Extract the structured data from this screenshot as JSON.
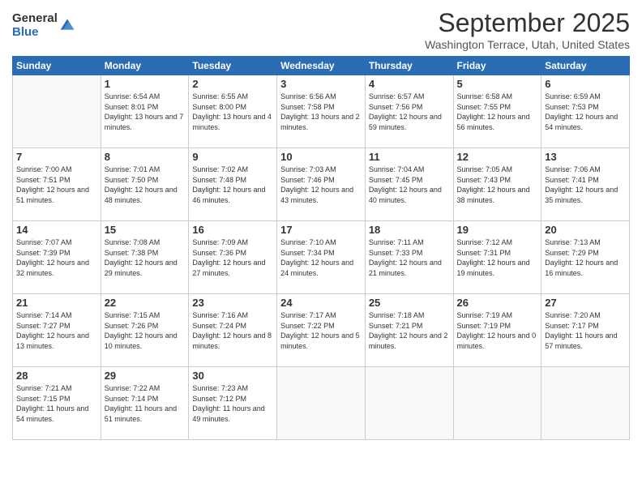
{
  "logo": {
    "general": "General",
    "blue": "Blue"
  },
  "header": {
    "month": "September 2025",
    "location": "Washington Terrace, Utah, United States"
  },
  "weekdays": [
    "Sunday",
    "Monday",
    "Tuesday",
    "Wednesday",
    "Thursday",
    "Friday",
    "Saturday"
  ],
  "weeks": [
    [
      {
        "day": "",
        "sunrise": "",
        "sunset": "",
        "daylight": ""
      },
      {
        "day": "1",
        "sunrise": "Sunrise: 6:54 AM",
        "sunset": "Sunset: 8:01 PM",
        "daylight": "Daylight: 13 hours and 7 minutes."
      },
      {
        "day": "2",
        "sunrise": "Sunrise: 6:55 AM",
        "sunset": "Sunset: 8:00 PM",
        "daylight": "Daylight: 13 hours and 4 minutes."
      },
      {
        "day": "3",
        "sunrise": "Sunrise: 6:56 AM",
        "sunset": "Sunset: 7:58 PM",
        "daylight": "Daylight: 13 hours and 2 minutes."
      },
      {
        "day": "4",
        "sunrise": "Sunrise: 6:57 AM",
        "sunset": "Sunset: 7:56 PM",
        "daylight": "Daylight: 12 hours and 59 minutes."
      },
      {
        "day": "5",
        "sunrise": "Sunrise: 6:58 AM",
        "sunset": "Sunset: 7:55 PM",
        "daylight": "Daylight: 12 hours and 56 minutes."
      },
      {
        "day": "6",
        "sunrise": "Sunrise: 6:59 AM",
        "sunset": "Sunset: 7:53 PM",
        "daylight": "Daylight: 12 hours and 54 minutes."
      }
    ],
    [
      {
        "day": "7",
        "sunrise": "Sunrise: 7:00 AM",
        "sunset": "Sunset: 7:51 PM",
        "daylight": "Daylight: 12 hours and 51 minutes."
      },
      {
        "day": "8",
        "sunrise": "Sunrise: 7:01 AM",
        "sunset": "Sunset: 7:50 PM",
        "daylight": "Daylight: 12 hours and 48 minutes."
      },
      {
        "day": "9",
        "sunrise": "Sunrise: 7:02 AM",
        "sunset": "Sunset: 7:48 PM",
        "daylight": "Daylight: 12 hours and 46 minutes."
      },
      {
        "day": "10",
        "sunrise": "Sunrise: 7:03 AM",
        "sunset": "Sunset: 7:46 PM",
        "daylight": "Daylight: 12 hours and 43 minutes."
      },
      {
        "day": "11",
        "sunrise": "Sunrise: 7:04 AM",
        "sunset": "Sunset: 7:45 PM",
        "daylight": "Daylight: 12 hours and 40 minutes."
      },
      {
        "day": "12",
        "sunrise": "Sunrise: 7:05 AM",
        "sunset": "Sunset: 7:43 PM",
        "daylight": "Daylight: 12 hours and 38 minutes."
      },
      {
        "day": "13",
        "sunrise": "Sunrise: 7:06 AM",
        "sunset": "Sunset: 7:41 PM",
        "daylight": "Daylight: 12 hours and 35 minutes."
      }
    ],
    [
      {
        "day": "14",
        "sunrise": "Sunrise: 7:07 AM",
        "sunset": "Sunset: 7:39 PM",
        "daylight": "Daylight: 12 hours and 32 minutes."
      },
      {
        "day": "15",
        "sunrise": "Sunrise: 7:08 AM",
        "sunset": "Sunset: 7:38 PM",
        "daylight": "Daylight: 12 hours and 29 minutes."
      },
      {
        "day": "16",
        "sunrise": "Sunrise: 7:09 AM",
        "sunset": "Sunset: 7:36 PM",
        "daylight": "Daylight: 12 hours and 27 minutes."
      },
      {
        "day": "17",
        "sunrise": "Sunrise: 7:10 AM",
        "sunset": "Sunset: 7:34 PM",
        "daylight": "Daylight: 12 hours and 24 minutes."
      },
      {
        "day": "18",
        "sunrise": "Sunrise: 7:11 AM",
        "sunset": "Sunset: 7:33 PM",
        "daylight": "Daylight: 12 hours and 21 minutes."
      },
      {
        "day": "19",
        "sunrise": "Sunrise: 7:12 AM",
        "sunset": "Sunset: 7:31 PM",
        "daylight": "Daylight: 12 hours and 19 minutes."
      },
      {
        "day": "20",
        "sunrise": "Sunrise: 7:13 AM",
        "sunset": "Sunset: 7:29 PM",
        "daylight": "Daylight: 12 hours and 16 minutes."
      }
    ],
    [
      {
        "day": "21",
        "sunrise": "Sunrise: 7:14 AM",
        "sunset": "Sunset: 7:27 PM",
        "daylight": "Daylight: 12 hours and 13 minutes."
      },
      {
        "day": "22",
        "sunrise": "Sunrise: 7:15 AM",
        "sunset": "Sunset: 7:26 PM",
        "daylight": "Daylight: 12 hours and 10 minutes."
      },
      {
        "day": "23",
        "sunrise": "Sunrise: 7:16 AM",
        "sunset": "Sunset: 7:24 PM",
        "daylight": "Daylight: 12 hours and 8 minutes."
      },
      {
        "day": "24",
        "sunrise": "Sunrise: 7:17 AM",
        "sunset": "Sunset: 7:22 PM",
        "daylight": "Daylight: 12 hours and 5 minutes."
      },
      {
        "day": "25",
        "sunrise": "Sunrise: 7:18 AM",
        "sunset": "Sunset: 7:21 PM",
        "daylight": "Daylight: 12 hours and 2 minutes."
      },
      {
        "day": "26",
        "sunrise": "Sunrise: 7:19 AM",
        "sunset": "Sunset: 7:19 PM",
        "daylight": "Daylight: 12 hours and 0 minutes."
      },
      {
        "day": "27",
        "sunrise": "Sunrise: 7:20 AM",
        "sunset": "Sunset: 7:17 PM",
        "daylight": "Daylight: 11 hours and 57 minutes."
      }
    ],
    [
      {
        "day": "28",
        "sunrise": "Sunrise: 7:21 AM",
        "sunset": "Sunset: 7:15 PM",
        "daylight": "Daylight: 11 hours and 54 minutes."
      },
      {
        "day": "29",
        "sunrise": "Sunrise: 7:22 AM",
        "sunset": "Sunset: 7:14 PM",
        "daylight": "Daylight: 11 hours and 51 minutes."
      },
      {
        "day": "30",
        "sunrise": "Sunrise: 7:23 AM",
        "sunset": "Sunset: 7:12 PM",
        "daylight": "Daylight: 11 hours and 49 minutes."
      },
      {
        "day": "",
        "sunrise": "",
        "sunset": "",
        "daylight": ""
      },
      {
        "day": "",
        "sunrise": "",
        "sunset": "",
        "daylight": ""
      },
      {
        "day": "",
        "sunrise": "",
        "sunset": "",
        "daylight": ""
      },
      {
        "day": "",
        "sunrise": "",
        "sunset": "",
        "daylight": ""
      }
    ]
  ]
}
